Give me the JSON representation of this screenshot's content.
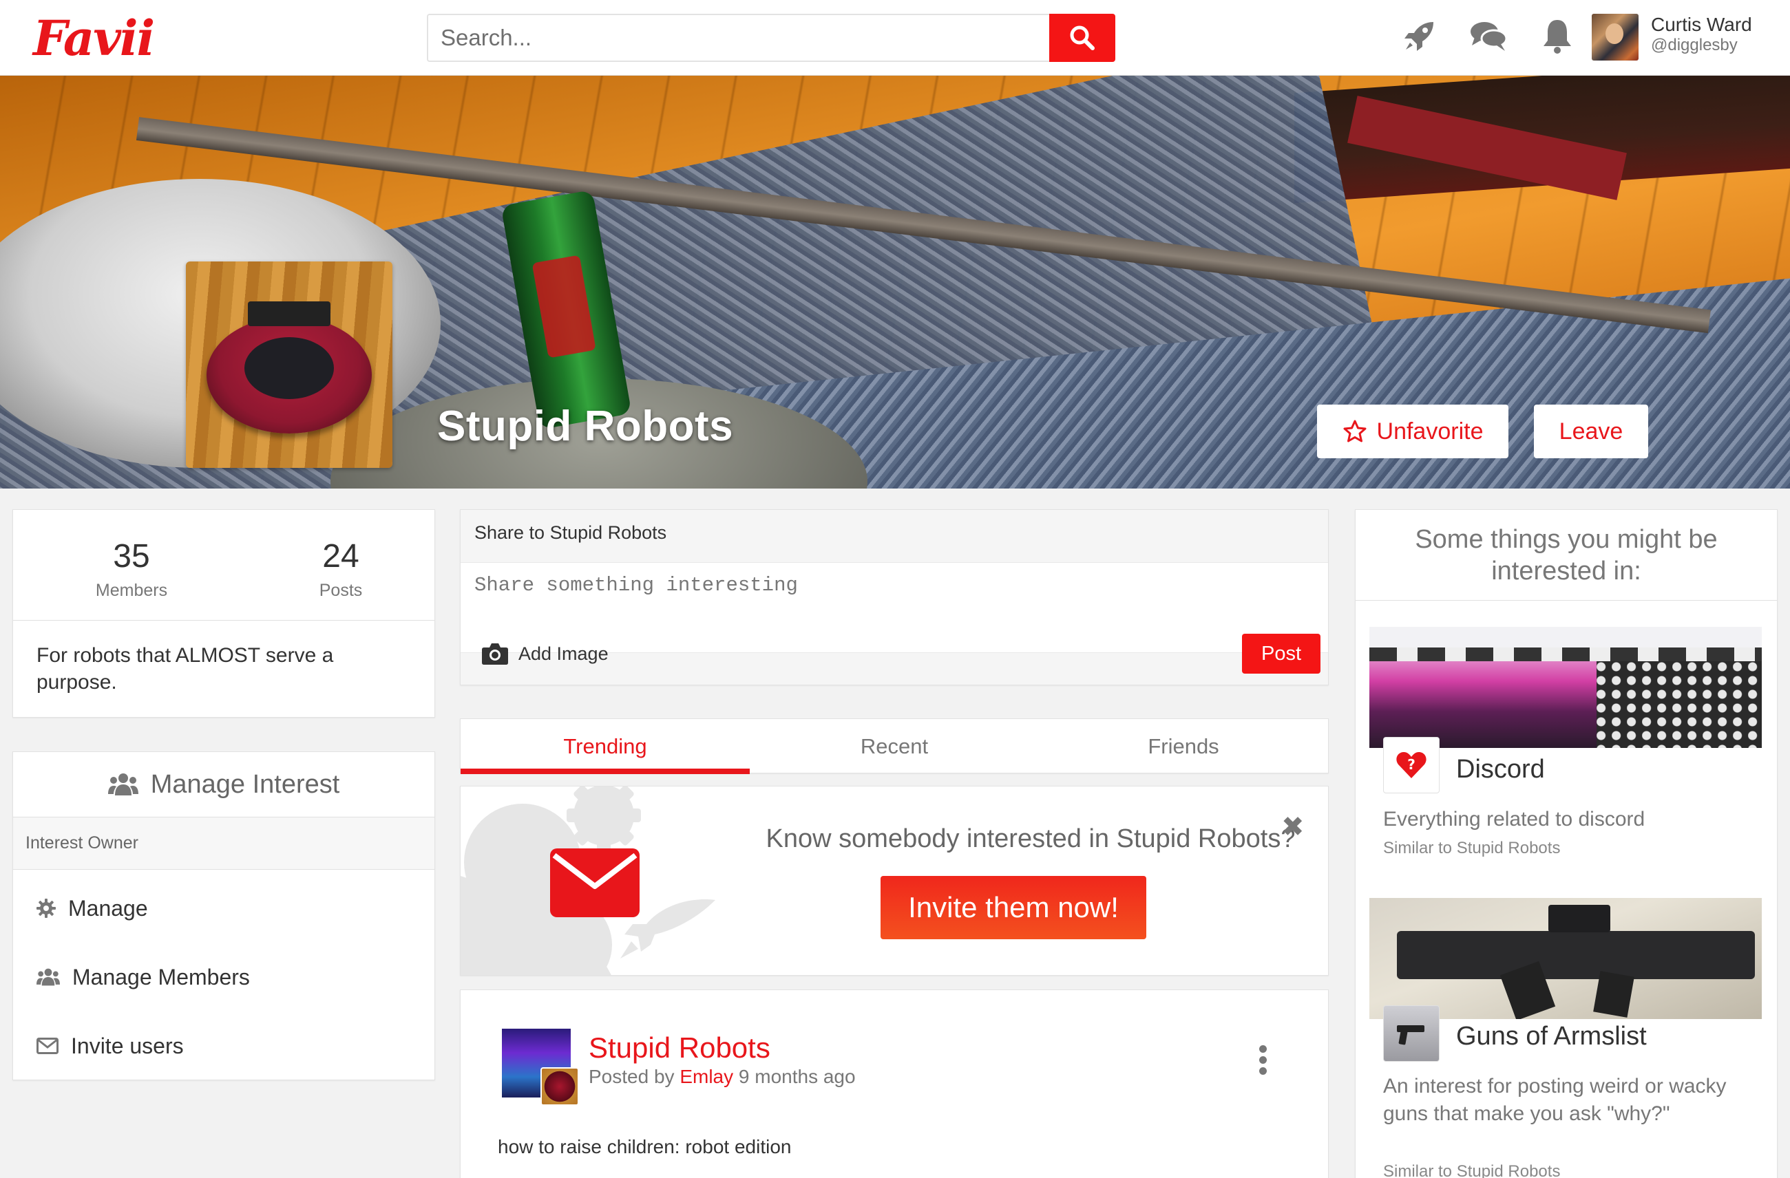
{
  "topbar": {
    "logo": "Favii",
    "search_placeholder": "Search...",
    "user": {
      "name": "Curtis Ward",
      "handle": "@digglesby"
    }
  },
  "hero": {
    "title": "Stupid Robots",
    "unfavorite_label": "Unfavorite",
    "leave_label": "Leave"
  },
  "stats": {
    "members_count": "35",
    "members_label": "Members",
    "posts_count": "24",
    "posts_label": "Posts",
    "description": "For robots that ALMOST serve a purpose."
  },
  "manage": {
    "title": "Manage Interest",
    "owner_label": "Interest Owner",
    "items": [
      {
        "label": "Manage",
        "icon": "gear-icon"
      },
      {
        "label": "Manage Members",
        "icon": "users-icon"
      },
      {
        "label": "Invite users",
        "icon": "envelope-icon"
      }
    ]
  },
  "share": {
    "header": "Share to Stupid Robots",
    "placeholder": "Share something interesting",
    "add_image_label": "Add Image",
    "post_label": "Post"
  },
  "tabs": [
    {
      "label": "Trending",
      "active": true
    },
    {
      "label": "Recent",
      "active": false
    },
    {
      "label": "Friends",
      "active": false
    }
  ],
  "invite": {
    "text": "Know somebody interested in Stupid Robots?",
    "button_label": "Invite them now!",
    "close_glyph": "✖"
  },
  "post": {
    "name": "Stupid Robots",
    "posted_by_prefix": "Posted by",
    "author": "Emlay",
    "time": "9 months ago",
    "body": "how to raise children: robot edition"
  },
  "suggestions": {
    "header": "Some things you might be interested in:",
    "items": [
      {
        "title": "Discord",
        "description": "Everything related to discord",
        "similar": "Similar to Stupid Robots"
      },
      {
        "title": "Guns of Armslist",
        "description": "An interest for posting weird or wacky guns that make you ask \"why?\"",
        "similar": "Similar to Stupid Robots"
      }
    ]
  },
  "colors": {
    "accent": "#e8161b",
    "button_red": "#f41515",
    "muted_text": "#777777"
  }
}
